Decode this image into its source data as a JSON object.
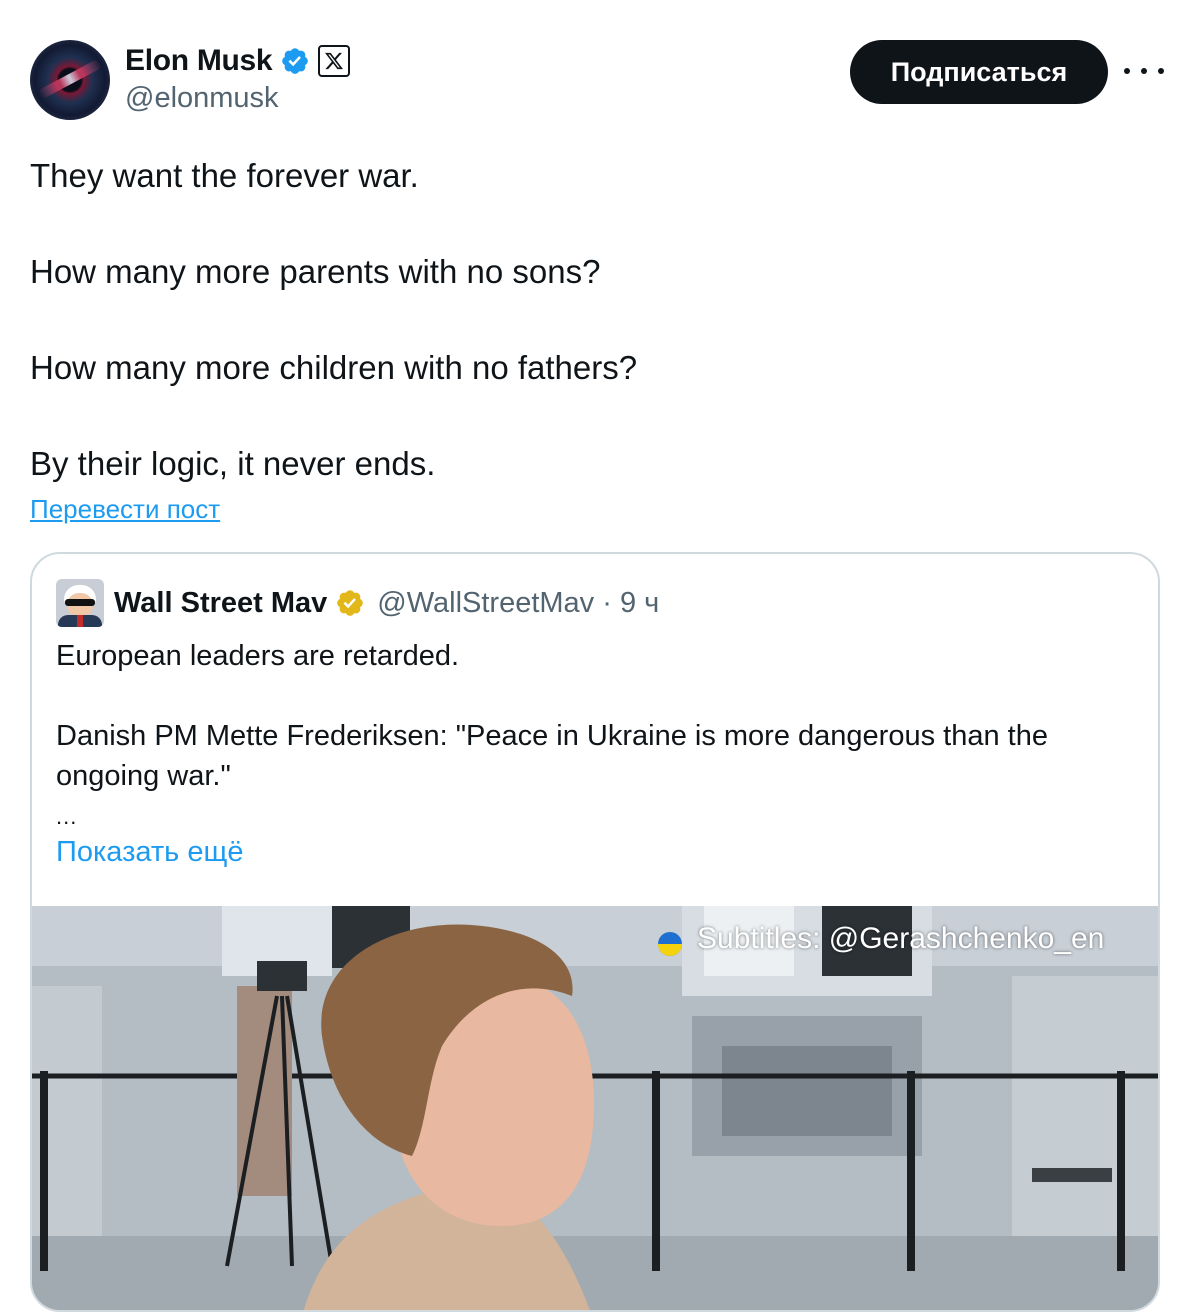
{
  "author": {
    "display_name": "Elon Musk",
    "handle": "@elonmusk",
    "avatar_icon": "black-hole-avatar",
    "verified_icon": "verified-badge-blue-icon",
    "affiliate_icon": "x-logo-icon"
  },
  "follow_button": {
    "label": "Подписаться"
  },
  "more_icon": "more-horizontal-icon",
  "post": {
    "paragraphs": [
      "They want the forever war.",
      "How many more parents with no sons?",
      "How many more children with no fathers?",
      "By their logic, it never ends."
    ],
    "translate_link": "Перевести пост"
  },
  "quote": {
    "display_name": "Wall Street Mav",
    "handle": "@WallStreetMav · 9 ч",
    "verified_icon": "verified-badge-gold-icon",
    "line1": "European leaders are retarded.",
    "line2": "Danish PM Mette Frederiksen:  \"Peace in Ukraine is more dangerous than the ongoing war.\"",
    "ellipsis": "...",
    "show_more": "Показать ещё",
    "video": {
      "subtitle_credit": "Subtitles: @Gerashchenko_en",
      "flag_icon": "ukraine-flag-icon"
    }
  },
  "colors": {
    "text": "#0f1419",
    "muted": "#536471",
    "link": "#1d9bf0",
    "verified_blue": "#1d9bf0",
    "verified_gold": "#e2b719",
    "button_bg": "#0f1419",
    "border": "#cfd9de"
  }
}
